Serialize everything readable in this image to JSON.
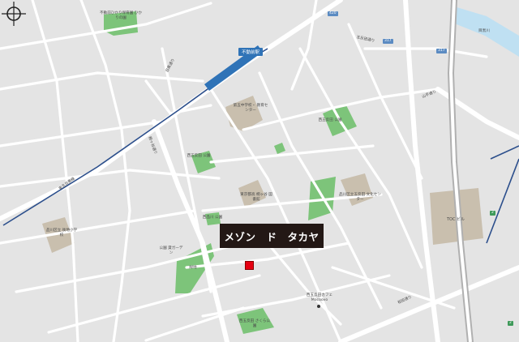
{
  "property": {
    "name": "メゾン　ド　タカヤ"
  },
  "station": {
    "name": "不動前駅"
  },
  "landmarks": {
    "park_top": "不動前ひかり保育園 ひかりの園",
    "school_mid": "第五中学校・ 教育センター",
    "nishi_park": "西五反田 公園",
    "kinder_park": "西品川 公園",
    "park_east": "西五反田 公園",
    "library": "東京都高 桐ヶ谷 図書館",
    "culture": "品川区立五反田 文化センター",
    "toc": "TOC ビル",
    "school_sw": "品川区立 後地小学校",
    "garden": "公園 貸ガーデン",
    "green_small": "緑地",
    "park_south": "西五反田 さくら公園",
    "cafe": "西五反田カフェ Mocoovo"
  },
  "roads": {
    "ramen": "目黒通り",
    "kamurozaka": "桐ヶ谷通り",
    "river": "目黒川",
    "tokyu": "東急目黒線",
    "yamate": "山手通り",
    "kajiwara": "五反田通り",
    "sakurada": "桜田通り"
  },
  "route_badges": [
    "420",
    "317",
    "317",
    "2",
    "2"
  ],
  "colors": {
    "background": "#e4e4e4",
    "road": "#ffffff",
    "park": "#7dc47a",
    "building": "#c9bfae",
    "water": "#bfe0f2",
    "rail": "#2c4f8c",
    "marker": "#e60012",
    "callout": "#231815"
  }
}
